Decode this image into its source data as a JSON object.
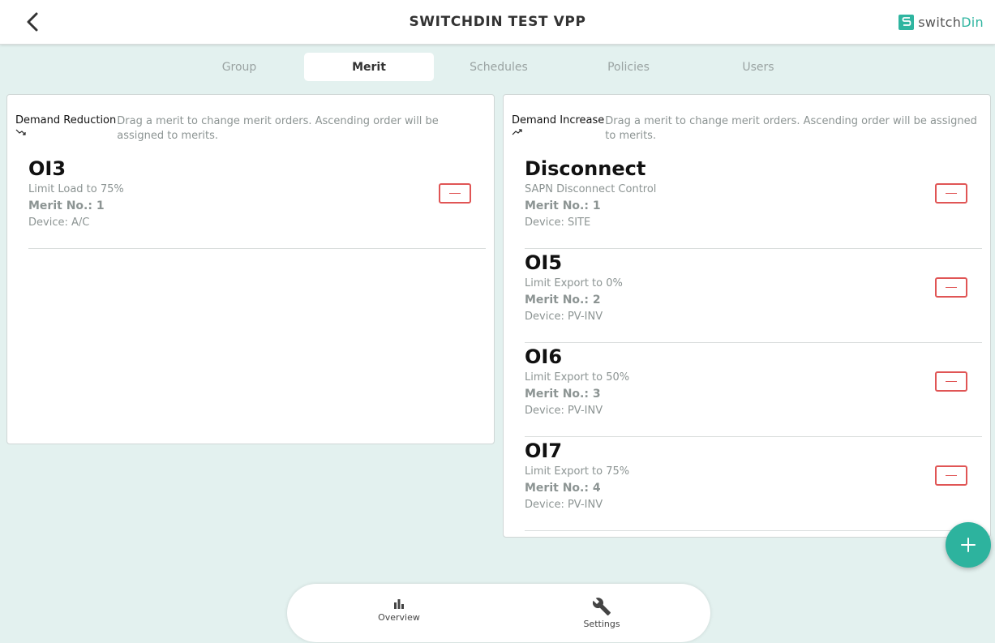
{
  "header": {
    "title": "SWITCHDIN TEST VPP",
    "logo_text_main": "switch",
    "logo_text_accent": "Din"
  },
  "tabs": [
    {
      "label": "Group"
    },
    {
      "label": "Merit",
      "active": true
    },
    {
      "label": "Schedules"
    },
    {
      "label": "Policies"
    },
    {
      "label": "Users"
    }
  ],
  "demand_reduction": {
    "title": "Demand Reduction",
    "hint": "Drag a merit to change merit orders. Ascending order will be assigned to merits.",
    "items": [
      {
        "name": "OI3",
        "desc": "Limit Load to 75%",
        "merit_no": "Merit No.: 1",
        "device": "Device: A/C"
      }
    ]
  },
  "demand_increase": {
    "title": "Demand Increase",
    "hint": "Drag a merit to change merit orders. Ascending order will be assigned to merits.",
    "items": [
      {
        "name": "Disconnect",
        "desc": "SAPN Disconnect Control",
        "merit_no": "Merit No.: 1",
        "device": "Device: SITE"
      },
      {
        "name": "OI5",
        "desc": "Limit Export to 0%",
        "merit_no": "Merit No.: 2",
        "device": "Device: PV-INV"
      },
      {
        "name": "OI6",
        "desc": "Limit Export to 50%",
        "merit_no": "Merit No.: 3",
        "device": "Device: PV-INV"
      },
      {
        "name": "OI7",
        "desc": "Limit Export to 75%",
        "merit_no": "Merit No.: 4",
        "device": "Device: PV-INV"
      }
    ]
  },
  "bottom_nav": {
    "overview_label": "Overview",
    "settings_label": "Settings"
  },
  "colors": {
    "accent": "#2fb5a0",
    "danger": "#e05555",
    "background": "#e3f1ef"
  }
}
